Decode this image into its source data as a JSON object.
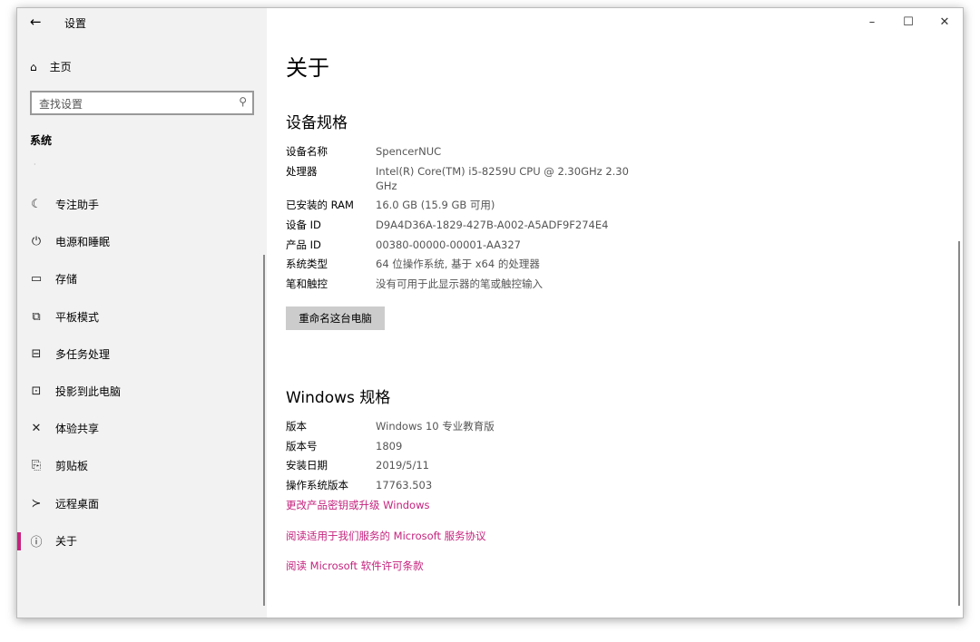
{
  "app": {
    "title": "设置",
    "back_icon": "arrow-left"
  },
  "sidebar": {
    "home": "主页",
    "search_placeholder": "查找设置",
    "section": "系统",
    "dot": "·",
    "items": [
      {
        "label": "专注助手",
        "icon": "☾"
      },
      {
        "label": "电源和睡眠",
        "icon": "⏻"
      },
      {
        "label": "存储",
        "icon": "▭"
      },
      {
        "label": "平板模式",
        "icon": "⧉"
      },
      {
        "label": "多任务处理",
        "icon": "⊟"
      },
      {
        "label": "投影到此电脑",
        "icon": "⊡"
      },
      {
        "label": "体验共享",
        "icon": "✕"
      },
      {
        "label": "剪贴板",
        "icon": "⎘"
      },
      {
        "label": "远程桌面",
        "icon": "≻"
      },
      {
        "label": "关于",
        "icon": "ⓘ"
      }
    ]
  },
  "window_controls": {
    "minimize": "–",
    "maximize": "☐",
    "close": "✕"
  },
  "main": {
    "title": "关于",
    "device_heading": "设备规格",
    "device_specs": [
      {
        "k": "设备名称",
        "v": "SpencerNUC"
      },
      {
        "k": "处理器",
        "v": "Intel(R) Core(TM) i5-8259U CPU @ 2.30GHz   2.30 GHz"
      },
      {
        "k": "已安装的 RAM",
        "v": "16.0 GB (15.9 GB 可用)"
      },
      {
        "k": "设备 ID",
        "v": "D9A4D36A-1829-427B-A002-A5ADF9F274E4"
      },
      {
        "k": "产品 ID",
        "v": "00380-00000-00001-AA327"
      },
      {
        "k": "系统类型",
        "v": "64 位操作系统, 基于 x64 的处理器"
      },
      {
        "k": "笔和触控",
        "v": "没有可用于此显示器的笔或触控输入"
      }
    ],
    "rename_button": "重命名这台电脑",
    "windows_heading": "Windows 规格",
    "windows_specs": [
      {
        "k": "版本",
        "v": "Windows 10 专业教育版"
      },
      {
        "k": "版本号",
        "v": "1809"
      },
      {
        "k": "安装日期",
        "v": "2019/5/11"
      },
      {
        "k": "操作系统版本",
        "v": "17763.503"
      }
    ],
    "links": [
      "更改产品密钥或升级 Windows",
      "阅读适用于我们服务的 Microsoft 服务协议",
      "阅读 Microsoft 软件许可条款"
    ],
    "accent": "#c4237e"
  }
}
